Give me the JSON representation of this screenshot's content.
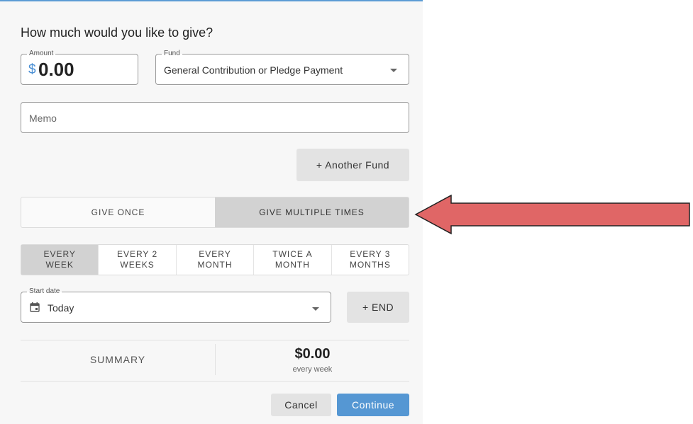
{
  "heading": "How much would you like to give?",
  "amount": {
    "legend": "Amount",
    "currency": "$",
    "value": "0.00"
  },
  "fund": {
    "legend": "Fund",
    "value": "General Contribution or Pledge Payment"
  },
  "memo": {
    "placeholder": "Memo"
  },
  "another_fund_label": "+ Another Fund",
  "frequency": {
    "once": "GIVE ONCE",
    "multiple": "GIVE MULTIPLE TIMES",
    "selected": "multiple"
  },
  "periods": [
    {
      "line1": "EVERY",
      "line2": "WEEK"
    },
    {
      "line1": "EVERY 2",
      "line2": "WEEKS"
    },
    {
      "line1": "EVERY",
      "line2": "MONTH"
    },
    {
      "line1": "TWICE A",
      "line2": "MONTH"
    },
    {
      "line1": "EVERY 3",
      "line2": "MONTHS"
    }
  ],
  "start_date": {
    "legend": "Start date",
    "value": "Today",
    "icon": "calendar-icon"
  },
  "end_label": "+ END",
  "summary": {
    "label": "SUMMARY",
    "amount": "$0.00",
    "sub": "every week"
  },
  "buttons": {
    "cancel": "Cancel",
    "continue": "Continue"
  },
  "colors": {
    "accent": "#5597d3",
    "arrow": "#e06666",
    "dollar": "#4a8fd4"
  }
}
